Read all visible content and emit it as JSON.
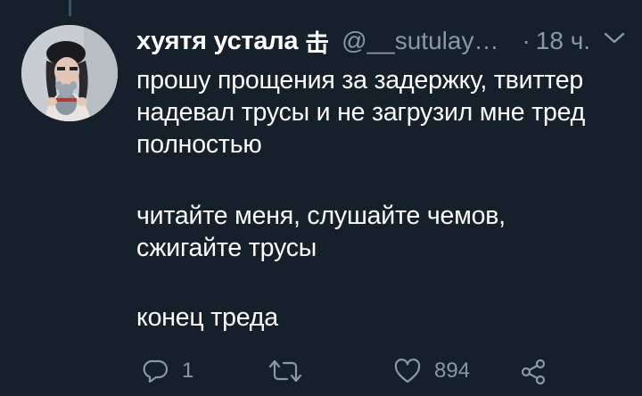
{
  "tweet": {
    "display_name": "хуятя устала",
    "name_glyph": "击",
    "handle": "@__sutulay…",
    "separator": "·",
    "time": "18 ч.",
    "lines_p1": [
      "прошу прощения за задержку, твиттер",
      "надевал трусы и не загрузил мне тред",
      "полностью"
    ],
    "lines_p2": [
      "читайте меня, слушайте чемов,",
      "сжигайте трусы"
    ],
    "lines_p3": [
      "конец треда"
    ]
  },
  "actions": {
    "reply_count": "1",
    "retweet_count": "",
    "like_count": "894"
  },
  "icons": {
    "reply": "reply-icon",
    "retweet": "retweet-icon",
    "like": "heart-icon",
    "share": "share-icon",
    "menu": "chevron-down-icon"
  },
  "colors": {
    "background": "#15202b",
    "text": "#ffffff",
    "secondary": "#8899a6",
    "thread_line": "#3d5466"
  }
}
